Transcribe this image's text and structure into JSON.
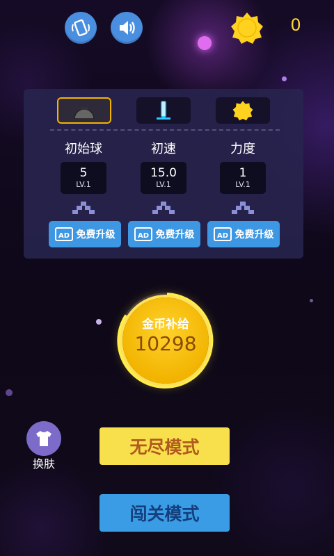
{
  "header": {
    "coins": "0"
  },
  "icons": {
    "vibrate": "vibrate-phone-icon",
    "sound": "speaker-icon",
    "coin": "gear-coin-icon",
    "upgrade_ad": "ad-icon",
    "skin": "tshirt-icon"
  },
  "upgrades": {
    "columns": [
      {
        "title": "初始球",
        "value": "5",
        "level": "LV.1",
        "button": "免费升级"
      },
      {
        "title": "初速",
        "value": "15.0",
        "level": "LV.1",
        "button": "免费升级"
      },
      {
        "title": "力度",
        "value": "1",
        "level": "LV.1",
        "button": "免费升级"
      }
    ]
  },
  "coin_supply": {
    "title": "金币补给",
    "value": "10298"
  },
  "skin": {
    "label": "换肤"
  },
  "modes": {
    "endless": "无尽模式",
    "level": "闯关模式"
  },
  "colors": {
    "accent_yellow": "#f8e04d",
    "accent_blue": "#3a9ce4",
    "coin_gold": "#f2b400"
  }
}
